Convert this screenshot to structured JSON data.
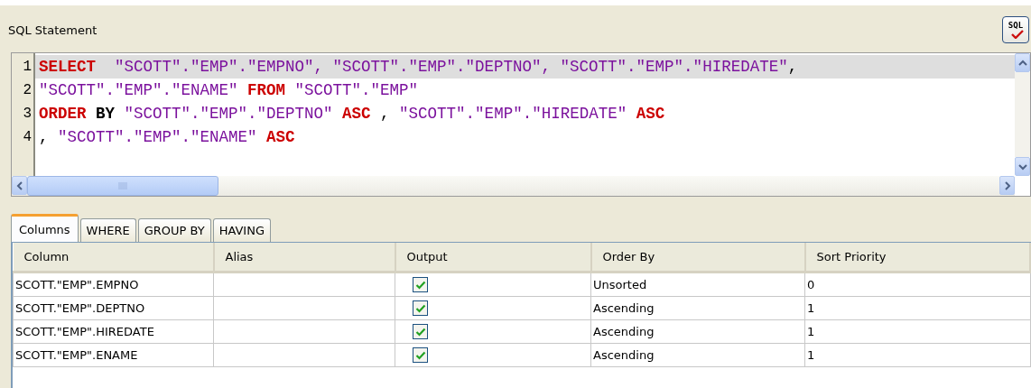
{
  "sql_panel": {
    "title": "SQL Statement",
    "validate_button": {
      "label": "SQL"
    },
    "lines": [
      {
        "number": "1",
        "current": true,
        "tokens": [
          {
            "text": "SELECT",
            "kind": "keyword"
          },
          {
            "text": "  \"SCOTT\".\"EMP\".\"EMPNO\", \"SCOTT\".\"EMP\".\"DEPTNO\", \"SCOTT\".\"EMP\".\"HIREDATE\"",
            "kind": "ident"
          },
          {
            "text": ",",
            "kind": "plain"
          }
        ]
      },
      {
        "number": "2",
        "current": false,
        "tokens": [
          {
            "text": "\"SCOTT\".\"EMP\".\"ENAME\" ",
            "kind": "ident"
          },
          {
            "text": "FROM",
            "kind": "keyword"
          },
          {
            "text": " \"SCOTT\".\"EMP\"",
            "kind": "ident"
          }
        ]
      },
      {
        "number": "3",
        "current": false,
        "tokens": [
          {
            "text": "ORDER",
            "kind": "keyword"
          },
          {
            "text": " BY",
            "kind": "bold"
          },
          {
            "text": " \"SCOTT\".\"EMP\".\"DEPTNO\" ",
            "kind": "ident"
          },
          {
            "text": "ASC",
            "kind": "keyword"
          },
          {
            "text": " , ",
            "kind": "plain"
          },
          {
            "text": "\"SCOTT\".\"EMP\".\"HIREDATE\" ",
            "kind": "ident"
          },
          {
            "text": "ASC",
            "kind": "keyword"
          }
        ]
      },
      {
        "number": "4",
        "current": false,
        "tokens": [
          {
            "text": ", ",
            "kind": "plain"
          },
          {
            "text": "\"SCOTT\".\"EMP\".\"ENAME\" ",
            "kind": "ident"
          },
          {
            "text": "ASC",
            "kind": "keyword"
          }
        ]
      }
    ]
  },
  "tabs": [
    {
      "label": "Columns",
      "selected": true
    },
    {
      "label": "WHERE",
      "selected": false
    },
    {
      "label": "GROUP BY",
      "selected": false
    },
    {
      "label": "HAVING",
      "selected": false
    }
  ],
  "table": {
    "columns": [
      "Column",
      "Alias",
      "Output",
      "Order By",
      "Sort Priority"
    ],
    "rows": [
      {
        "column": "SCOTT.\"EMP\".EMPNO",
        "output": true,
        "order_by": "Unsorted",
        "sort_priority": "0"
      },
      {
        "column": "SCOTT.\"EMP\".DEPTNO",
        "output": true,
        "order_by": "Ascending",
        "sort_priority": "1"
      },
      {
        "column": "SCOTT.\"EMP\".HIREDATE",
        "output": true,
        "order_by": "Ascending",
        "sort_priority": "1"
      },
      {
        "column": "SCOTT.\"EMP\".ENAME",
        "output": true,
        "order_by": "Ascending",
        "sort_priority": "1"
      }
    ]
  }
}
